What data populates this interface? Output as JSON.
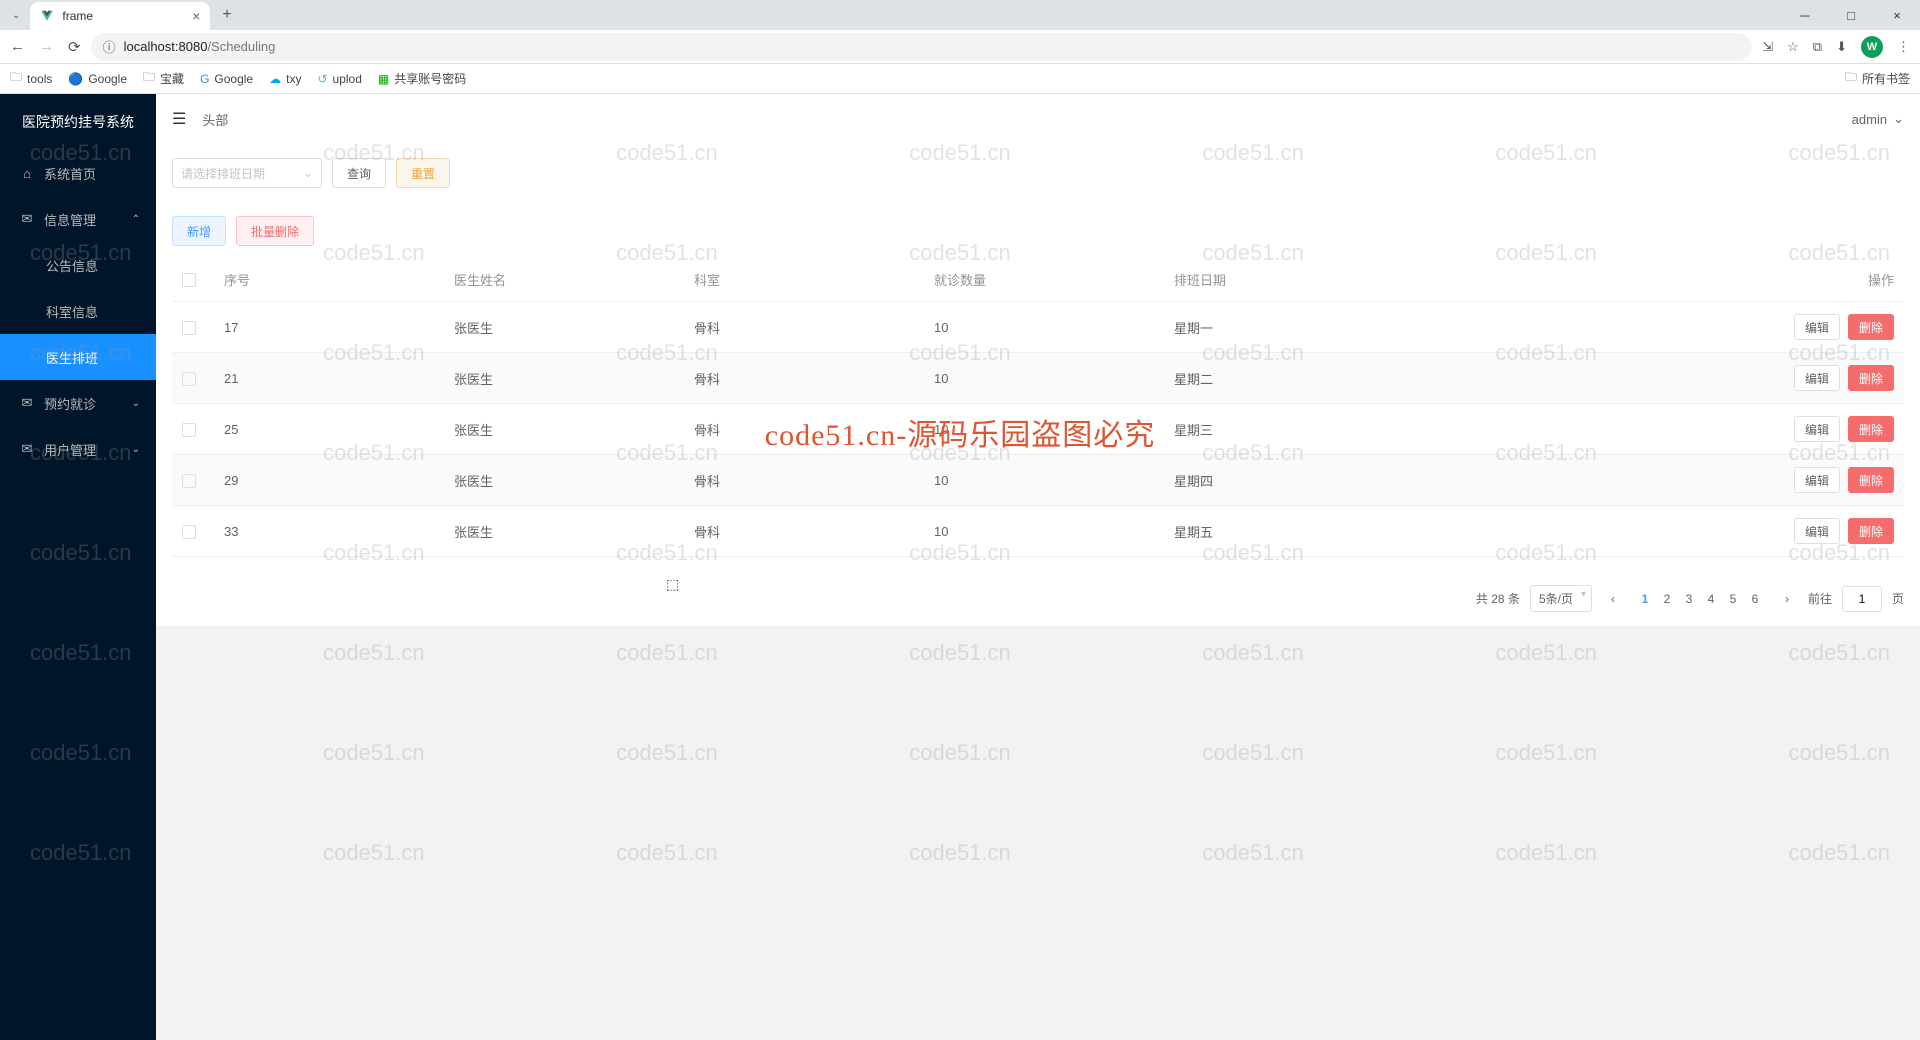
{
  "browser": {
    "tab_title": "frame",
    "url_scheme_icon": "ⓘ",
    "url_host": "localhost:8080",
    "url_path": "/Scheduling",
    "bookmarks": [
      "tools",
      "Google",
      "宝藏",
      "Google",
      "txy",
      "uplod",
      "共享账号密码"
    ],
    "all_bookmarks": "所有书签"
  },
  "app": {
    "title": "医院预约挂号系统",
    "breadcrumb": "头部",
    "user": "admin"
  },
  "menu": {
    "home": "系统首页",
    "info": "信息管理",
    "notice": "公告信息",
    "dept": "科室信息",
    "sched": "医生排班",
    "appt": "预约就诊",
    "users": "用户管理"
  },
  "filter": {
    "placeholder": "请选择排班日期",
    "search": "查询",
    "reset": "重置",
    "add": "新增",
    "batch_delete": "批量删除"
  },
  "table": {
    "headers": {
      "seq": "序号",
      "doctor": "医生姓名",
      "dept": "科室",
      "count": "就诊数量",
      "day": "排班日期",
      "ops": "操作"
    },
    "edit": "编辑",
    "delete": "删除",
    "rows": [
      {
        "seq": "17",
        "doctor": "张医生",
        "dept": "骨科",
        "count": "10",
        "day": "星期一"
      },
      {
        "seq": "21",
        "doctor": "张医生",
        "dept": "骨科",
        "count": "10",
        "day": "星期二"
      },
      {
        "seq": "25",
        "doctor": "张医生",
        "dept": "骨科",
        "count": "10",
        "day": "星期三"
      },
      {
        "seq": "29",
        "doctor": "张医生",
        "dept": "骨科",
        "count": "10",
        "day": "星期四"
      },
      {
        "seq": "33",
        "doctor": "张医生",
        "dept": "骨科",
        "count": "10",
        "day": "星期五"
      }
    ]
  },
  "pager": {
    "total": "共 28 条",
    "size": "5条/页",
    "pages": [
      "1",
      "2",
      "3",
      "4",
      "5",
      "6"
    ],
    "goto": "前往",
    "goto_val": "1",
    "page_suffix": "页"
  },
  "watermark": {
    "text": "code51.cn",
    "center": "code51.cn-源码乐园盗图必究"
  }
}
